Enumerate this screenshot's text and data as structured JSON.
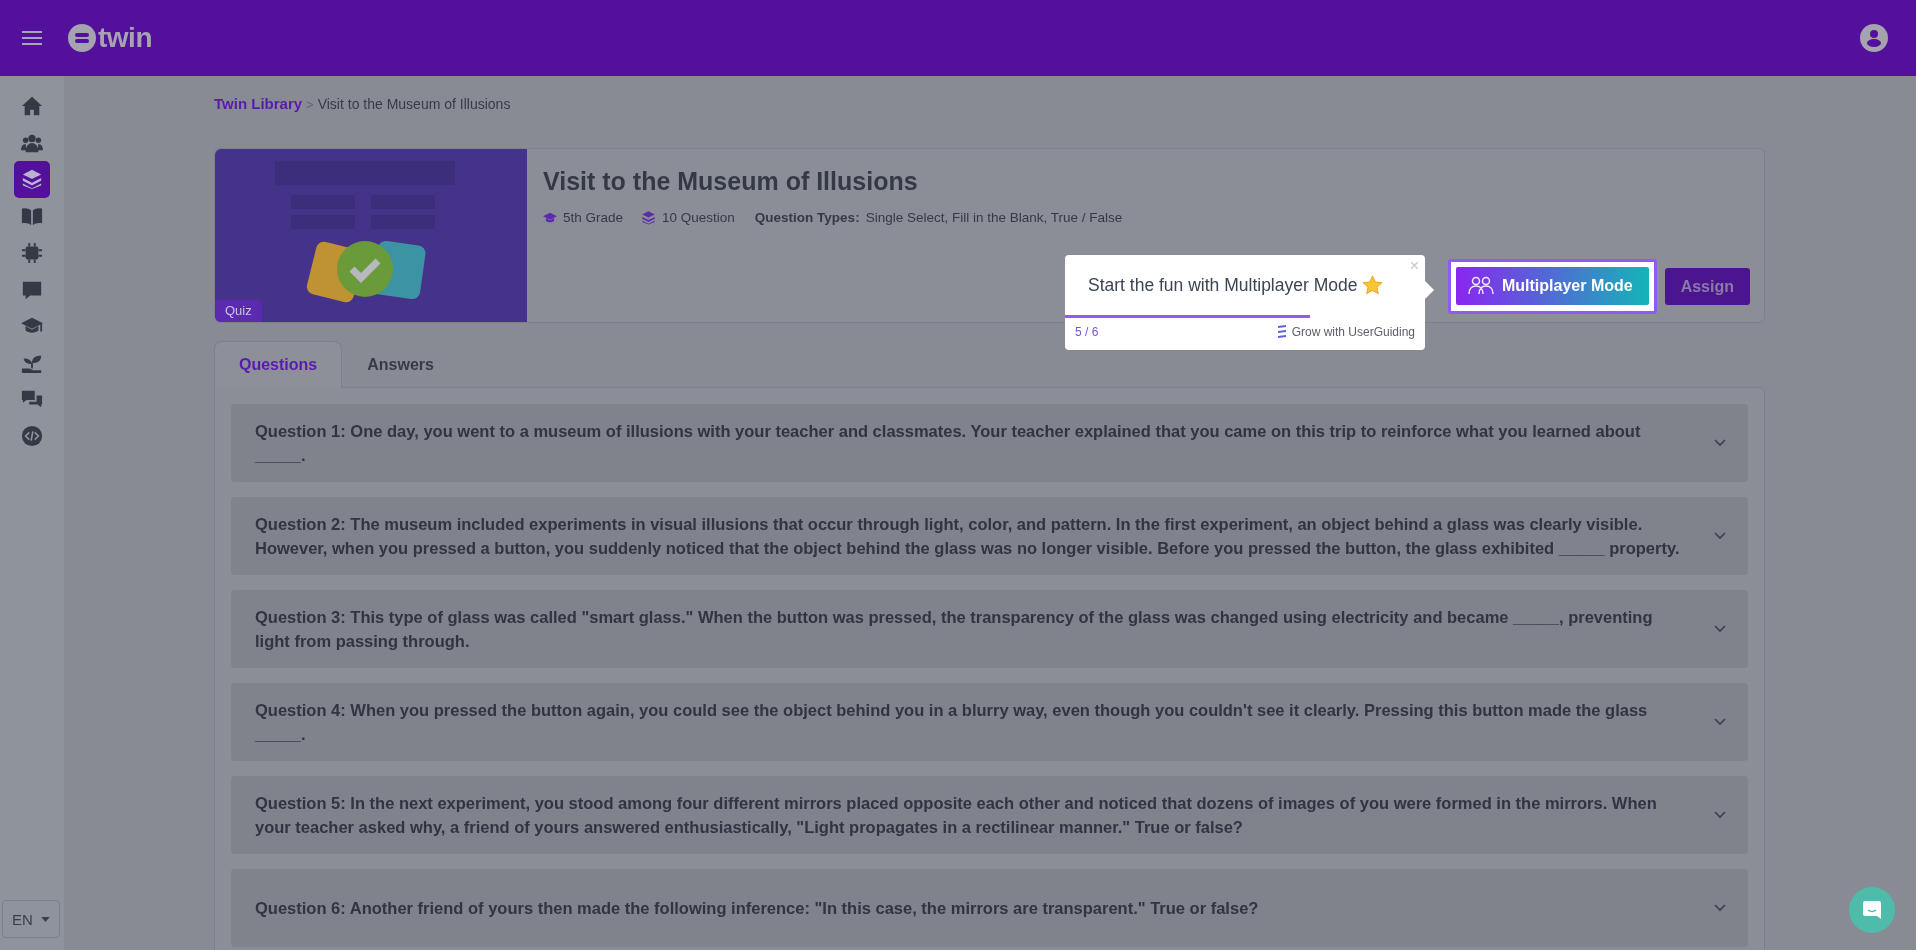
{
  "header": {
    "logo": "twin"
  },
  "sidebar": {
    "items": [
      {
        "selected": false
      },
      {
        "selected": false
      },
      {
        "selected": true
      },
      {
        "selected": false
      },
      {
        "selected": false
      },
      {
        "selected": false
      },
      {
        "selected": false
      },
      {
        "selected": false
      },
      {
        "selected": false
      },
      {
        "selected": false
      }
    ],
    "language": "EN"
  },
  "breadcrumb": {
    "link": "Twin Library",
    "separator": ">",
    "current": "Visit to the Museum of Illusions"
  },
  "card": {
    "badge": "Quiz",
    "title": "Visit to the Museum of Illusions",
    "grade": "5th Grade",
    "question_count": "10 Question",
    "types_label": "Question Types:",
    "types": "Single Select, Fill in the Blank, True / False",
    "multiplayer_button": "Multiplayer Mode",
    "assign_button": "Assign"
  },
  "tour_tooltip": {
    "text": "Start the fun with Multiplayer Mode",
    "close": "×",
    "level": 0.68,
    "step": "5 / 6",
    "brand": "Grow with UserGuiding"
  },
  "tabs": [
    {
      "label": "Questions",
      "selected": true
    },
    {
      "label": "Answers",
      "selected": false
    }
  ],
  "questions": [
    {
      "text": "Question 1: One day, you went to a museum of illusions with your teacher and classmates. Your teacher explained that you came on this trip to reinforce what you learned about _____.",
      "expanded": false
    },
    {
      "text": "Question 2: The museum included experiments in visual illusions that occur through light, color, and pattern. In the first experiment, an object behind a glass was clearly visible. However, when you pressed a button, you suddenly noticed that the object behind the glass was no longer visible. Before you pressed the button, the glass exhibited _____ property.",
      "expanded": false
    },
    {
      "text": "Question 3: This type of glass was called \"smart glass.\" When the button was pressed, the transparency of the glass was changed using electricity and became _____, preventing light from passing through.",
      "expanded": false
    },
    {
      "text": "Question 4: When you pressed the button again, you could see the object behind you in a blurry way, even though you couldn't see it clearly. Pressing this button made the glass _____.",
      "expanded": false
    },
    {
      "text": "Question 5: In the next experiment, you stood among four different mirrors placed opposite each other and noticed that dozens of images of you were formed in the mirrors. When your teacher asked why, a friend of yours answered enthusiastically, \"Light propagates in a rectilinear manner.\" True or false?",
      "expanded": false
    },
    {
      "text": "Question 6: Another friend of yours then made the following inference: \"In this case, the mirrors are transparent.\" True or false?",
      "expanded": false
    }
  ]
}
